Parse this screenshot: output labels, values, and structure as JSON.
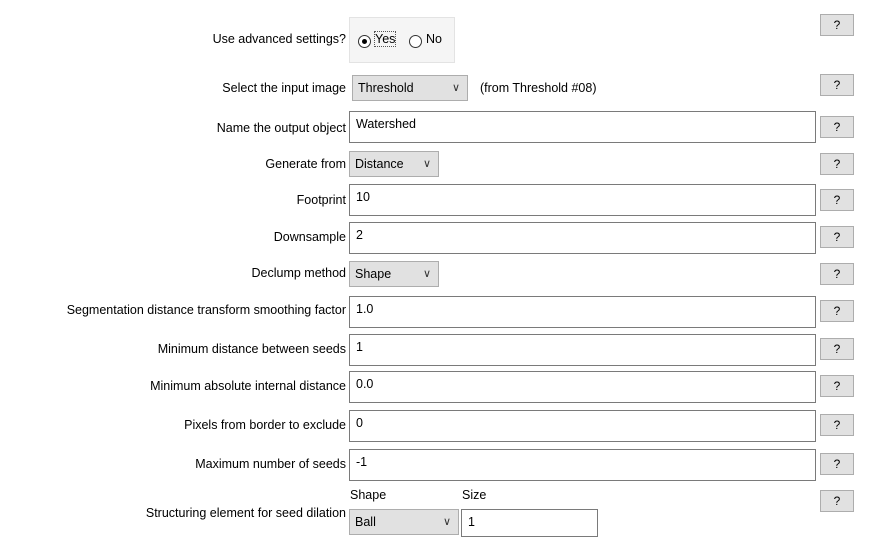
{
  "help_label": "?",
  "advanced": {
    "label": "Use advanced settings?",
    "yes": "Yes",
    "no": "No",
    "selected": "Yes"
  },
  "input_image": {
    "label": "Select the input image",
    "value": "Threshold",
    "note": "(from Threshold #08)"
  },
  "output_object": {
    "label": "Name the output object",
    "value": "Watershed"
  },
  "generate_from": {
    "label": "Generate from",
    "value": "Distance"
  },
  "footprint": {
    "label": "Footprint",
    "value": "10"
  },
  "downsample": {
    "label": "Downsample",
    "value": "2"
  },
  "declump": {
    "label": "Declump method",
    "value": "Shape"
  },
  "smoothing": {
    "label": "Segmentation distance transform smoothing factor",
    "value": "1.0"
  },
  "min_distance": {
    "label": "Minimum distance between seeds",
    "value": "1"
  },
  "min_internal": {
    "label": "Minimum absolute internal distance",
    "value": "0.0"
  },
  "border": {
    "label": "Pixels from border to exclude",
    "value": "0"
  },
  "max_seeds": {
    "label": "Maximum number of seeds",
    "value": "-1"
  },
  "structuring": {
    "label": "Structuring element for seed dilation",
    "shape_header": "Shape",
    "size_header": "Size",
    "shape_value": "Ball",
    "size_value": "1"
  }
}
